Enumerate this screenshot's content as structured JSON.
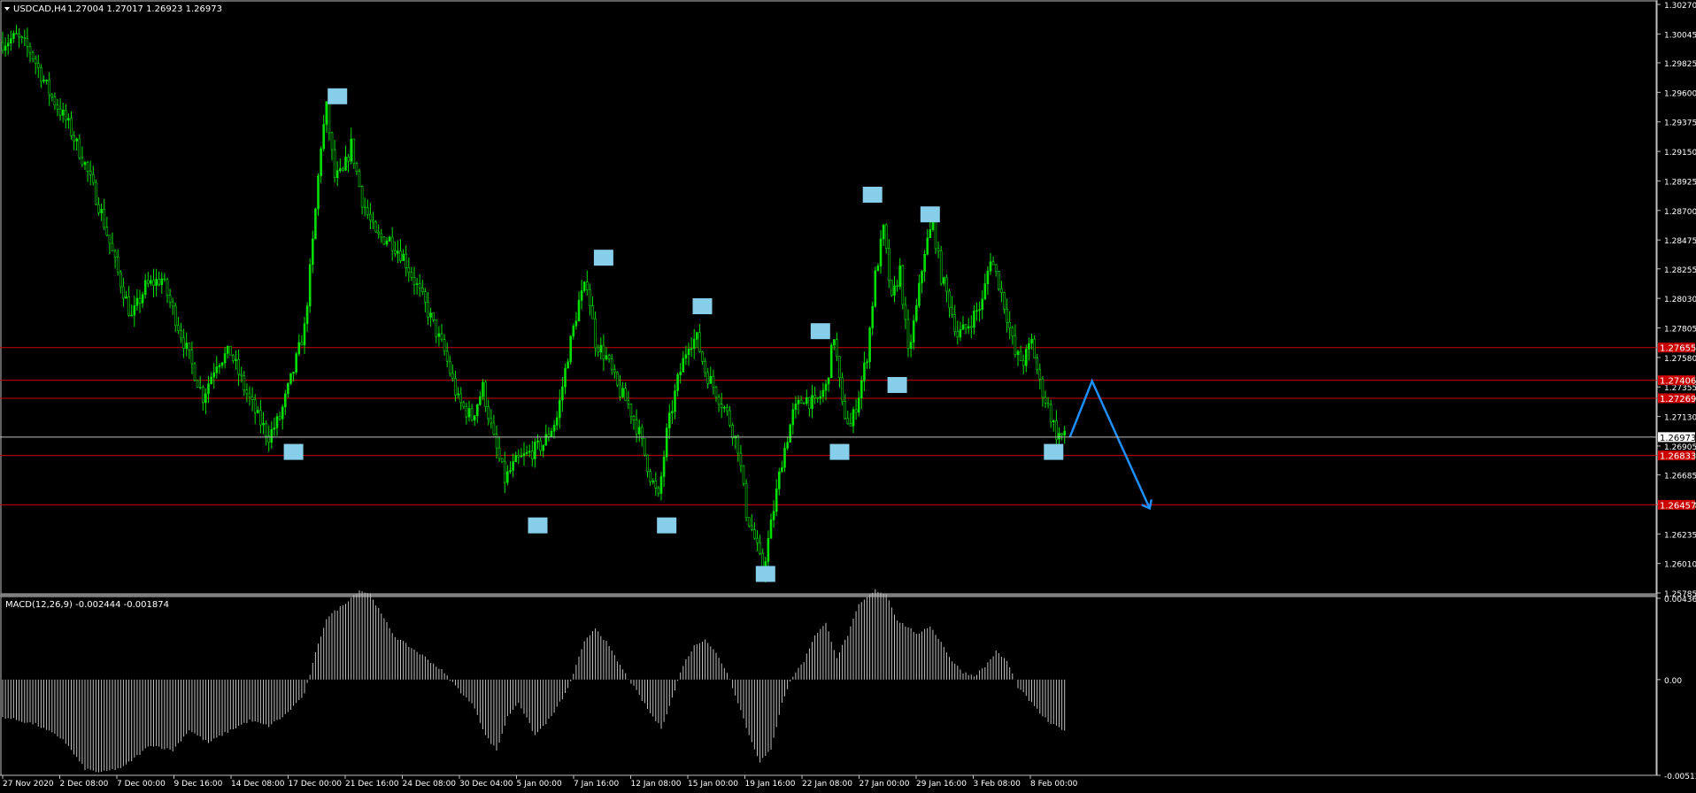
{
  "header": {
    "symbol": "USDCAD,H4",
    "ohlc": "1.27004 1.27017 1.26923 1.26973",
    "menu_icon": "triangle-down-icon"
  },
  "macd": {
    "label": "MACD(12,26,9) -0.002444 -0.001874"
  },
  "colors": {
    "background": "#000000",
    "candle": "#00e000",
    "level_line": "#cc0000",
    "marker": "#87ceeb",
    "arrow": "#1e90ff",
    "macd_bar": "#c0c0c0",
    "grid_frame": "#c0c0c0"
  },
  "chart_data": [
    {
      "type": "candlestick",
      "title": "USDCAD,H4",
      "ylim": [
        1.25785,
        1.3027
      ],
      "price_ticks": [
        "1.30270",
        "1.30045",
        "1.29825",
        "1.29600",
        "1.29375",
        "1.29150",
        "1.28925",
        "1.28700",
        "1.28475",
        "1.28255",
        "1.28030",
        "1.27805",
        "1.27580",
        "1.27355",
        "1.27130",
        "1.26905",
        "1.26685",
        "1.26460",
        "1.26235",
        "1.26010",
        "1.25785"
      ],
      "time_ticks": [
        "27 Nov 2020",
        "2 Dec 08:00",
        "7 Dec 00:00",
        "9 Dec 16:00",
        "14 Dec 08:00",
        "17 Dec 00:00",
        "21 Dec 16:00",
        "24 Dec 08:00",
        "30 Dec 04:00",
        "5 Jan 00:00",
        "7 Jan 16:00",
        "12 Jan 08:00",
        "15 Jan 00:00",
        "19 Jan 16:00",
        "22 Jan 08:00",
        "27 Jan 00:00",
        "29 Jan 16:00",
        "3 Feb 08:00",
        "8 Feb 00:00"
      ],
      "current_price": "1.26973",
      "levels": [
        {
          "value": 1.27655,
          "label": "1.27655"
        },
        {
          "value": 1.27406,
          "label": "1.27406"
        },
        {
          "value": 1.27269,
          "label": "1.27269"
        },
        {
          "value": 1.26833,
          "label": "1.26833"
        },
        {
          "value": 1.26457,
          "label": "1.26457"
        }
      ],
      "close_series_path": [
        [
          0,
          1.2998
        ],
        [
          5,
          1.3002
        ],
        [
          10,
          1.2992
        ],
        [
          17,
          1.296
        ],
        [
          24,
          1.2935
        ],
        [
          30,
          1.2905
        ],
        [
          36,
          1.2868
        ],
        [
          42,
          1.2822
        ],
        [
          47,
          1.2788
        ],
        [
          52,
          1.2812
        ],
        [
          58,
          1.2818
        ],
        [
          63,
          1.2788
        ],
        [
          68,
          1.2758
        ],
        [
          73,
          1.2728
        ],
        [
          78,
          1.2755
        ],
        [
          83,
          1.2762
        ],
        [
          88,
          1.2735
        ],
        [
          93,
          1.2712
        ],
        [
          97,
          1.2698
        ],
        [
          101,
          1.2712
        ],
        [
          106,
          1.2748
        ],
        [
          110,
          1.278
        ],
        [
          113,
          1.2845
        ],
        [
          116,
          1.292
        ],
        [
          118,
          1.2948
        ],
        [
          121,
          1.2895
        ],
        [
          124,
          1.2898
        ],
        [
          127,
          1.292
        ],
        [
          131,
          1.2878
        ],
        [
          136,
          1.285
        ],
        [
          141,
          1.2848
        ],
        [
          146,
          1.2835
        ],
        [
          151,
          1.2812
        ],
        [
          156,
          1.2788
        ],
        [
          161,
          1.2762
        ],
        [
          166,
          1.2725
        ],
        [
          171,
          1.2712
        ],
        [
          175,
          1.2735
        ],
        [
          179,
          1.2695
        ],
        [
          183,
          1.2665
        ],
        [
          187,
          1.2678
        ],
        [
          192,
          1.2685
        ],
        [
          197,
          1.2692
        ],
        [
          202,
          1.2712
        ],
        [
          206,
          1.276
        ],
        [
          210,
          1.28
        ],
        [
          213,
          1.2815
        ],
        [
          216,
          1.277
        ],
        [
          220,
          1.2758
        ],
        [
          224,
          1.2735
        ],
        [
          228,
          1.2722
        ],
        [
          232,
          1.27
        ],
        [
          236,
          1.2668
        ],
        [
          239,
          1.265
        ],
        [
          242,
          1.27
        ],
        [
          246,
          1.274
        ],
        [
          250,
          1.277
        ],
        [
          253,
          1.2772
        ],
        [
          256,
          1.2748
        ],
        [
          260,
          1.2732
        ],
        [
          264,
          1.2715
        ],
        [
          268,
          1.269
        ],
        [
          271,
          1.264
        ],
        [
          274,
          1.262
        ],
        [
          277,
          1.2595
        ],
        [
          280,
          1.263
        ],
        [
          284,
          1.268
        ],
        [
          288,
          1.2715
        ],
        [
          292,
          1.2728
        ],
        [
          296,
          1.2722
        ],
        [
          300,
          1.2735
        ],
        [
          303,
          1.2775
        ],
        [
          306,
          1.272
        ],
        [
          309,
          1.2705
        ],
        [
          312,
          1.273
        ],
        [
          315,
          1.276
        ],
        [
          318,
          1.282
        ],
        [
          321,
          1.2855
        ],
        [
          324,
          1.28
        ],
        [
          327,
          1.2825
        ],
        [
          330,
          1.276
        ],
        [
          333,
          1.2795
        ],
        [
          336,
          1.284
        ],
        [
          339,
          1.286
        ],
        [
          342,
          1.282
        ],
        [
          345,
          1.28
        ],
        [
          348,
          1.2775
        ],
        [
          351,
          1.278
        ],
        [
          354,
          1.279
        ],
        [
          357,
          1.28
        ],
        [
          360,
          1.2835
        ],
        [
          363,
          1.2815
        ],
        [
          366,
          1.279
        ],
        [
          369,
          1.276
        ],
        [
          372,
          1.2755
        ],
        [
          375,
          1.277
        ],
        [
          378,
          1.2738
        ],
        [
          381,
          1.272
        ],
        [
          384,
          1.27
        ],
        [
          387,
          1.2697
        ]
      ],
      "n_bars": 388,
      "markers": [
        {
          "bar": 106,
          "price": 1.2686
        },
        {
          "bar": 122,
          "price": 1.2957
        },
        {
          "bar": 195,
          "price": 1.263
        },
        {
          "bar": 219,
          "price": 1.2834
        },
        {
          "bar": 242,
          "price": 1.263
        },
        {
          "bar": 255,
          "price": 1.2797
        },
        {
          "bar": 278,
          "price": 1.2593
        },
        {
          "bar": 298,
          "price": 1.2778
        },
        {
          "bar": 305,
          "price": 1.2686
        },
        {
          "bar": 317,
          "price": 1.2882
        },
        {
          "bar": 326,
          "price": 1.2737
        },
        {
          "bar": 338,
          "price": 1.2867
        },
        {
          "bar": 383,
          "price": 1.2686
        }
      ],
      "projection": {
        "start": {
          "bar": 387,
          "price": 1.26973
        },
        "peak": {
          "bar": 397,
          "price": 1.274
        },
        "end": {
          "bar": 418,
          "price": 1.2643
        }
      }
    },
    {
      "type": "bar",
      "title": "MACD(12,26,9)",
      "ylim": [
        -0.005139,
        0.004364
      ],
      "tick_labels": [
        "0.004364",
        "0.00",
        "-0.005139"
      ],
      "anchors": [
        [
          0,
          -0.002
        ],
        [
          12,
          -0.0024
        ],
        [
          22,
          -0.0032
        ],
        [
          30,
          -0.0048
        ],
        [
          36,
          -0.005
        ],
        [
          44,
          -0.0047
        ],
        [
          54,
          -0.0035
        ],
        [
          62,
          -0.0038
        ],
        [
          68,
          -0.0027
        ],
        [
          75,
          -0.0034
        ],
        [
          82,
          -0.0028
        ],
        [
          90,
          -0.0022
        ],
        [
          97,
          -0.0025
        ],
        [
          103,
          -0.0019
        ],
        [
          110,
          -0.0008
        ],
        [
          114,
          0.0014
        ],
        [
          118,
          0.0033
        ],
        [
          124,
          0.004
        ],
        [
          130,
          0.0048
        ],
        [
          134,
          0.0046
        ],
        [
          138,
          0.0035
        ],
        [
          143,
          0.0023
        ],
        [
          148,
          0.0018
        ],
        [
          154,
          0.0012
        ],
        [
          160,
          0.0005
        ],
        [
          166,
          -0.0005
        ],
        [
          172,
          -0.0015
        ],
        [
          176,
          -0.003
        ],
        [
          180,
          -0.0038
        ],
        [
          184,
          -0.002
        ],
        [
          188,
          -0.0012
        ],
        [
          194,
          -0.003
        ],
        [
          200,
          -0.002
        ],
        [
          206,
          -0.0005
        ],
        [
          212,
          0.002
        ],
        [
          216,
          0.0028
        ],
        [
          220,
          0.002
        ],
        [
          224,
          0.001
        ],
        [
          230,
          -0.0004
        ],
        [
          236,
          -0.0018
        ],
        [
          240,
          -0.0026
        ],
        [
          244,
          -0.001
        ],
        [
          248,
          0.0008
        ],
        [
          252,
          0.0018
        ],
        [
          256,
          0.0022
        ],
        [
          260,
          0.0014
        ],
        [
          264,
          0.0004
        ],
        [
          268,
          -0.0012
        ],
        [
          272,
          -0.003
        ],
        [
          276,
          -0.0044
        ],
        [
          280,
          -0.0038
        ],
        [
          284,
          -0.0012
        ],
        [
          288,
          0.0002
        ],
        [
          292,
          0.001
        ],
        [
          296,
          0.0024
        ],
        [
          300,
          0.003
        ],
        [
          304,
          0.0012
        ],
        [
          308,
          0.0024
        ],
        [
          312,
          0.004
        ],
        [
          318,
          0.0048
        ],
        [
          322,
          0.0046
        ],
        [
          326,
          0.0032
        ],
        [
          330,
          0.0028
        ],
        [
          334,
          0.0024
        ],
        [
          338,
          0.0029
        ],
        [
          342,
          0.002
        ],
        [
          346,
          0.001
        ],
        [
          350,
          0.0004
        ],
        [
          354,
          0.0002
        ],
        [
          358,
          0.0007
        ],
        [
          362,
          0.0015
        ],
        [
          366,
          0.001
        ],
        [
          370,
          -0.0004
        ],
        [
          374,
          -0.0011
        ],
        [
          378,
          -0.0018
        ],
        [
          382,
          -0.0024
        ],
        [
          387,
          -0.0027
        ]
      ]
    }
  ]
}
